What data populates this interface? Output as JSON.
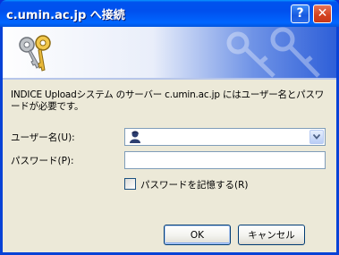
{
  "window": {
    "title": "c.umin.ac.jp へ接続",
    "help_label": "?",
    "close_label": "✕"
  },
  "message": "INDICE Uploadシステム のサーバー c.umin.ac.jp にはユーザー名とパスワードが必要です。",
  "form": {
    "user_label": "ユーザー名(U):",
    "user_value": "",
    "password_label": "パスワード(P):",
    "password_value": "",
    "remember_label": "パスワードを記憶する(R)",
    "remember_checked": false
  },
  "buttons": {
    "ok": "OK",
    "cancel": "キャンセル"
  },
  "colors": {
    "titlebar": "#0053ee",
    "client_bg": "#ece9d8",
    "input_border": "#7f9db9"
  }
}
